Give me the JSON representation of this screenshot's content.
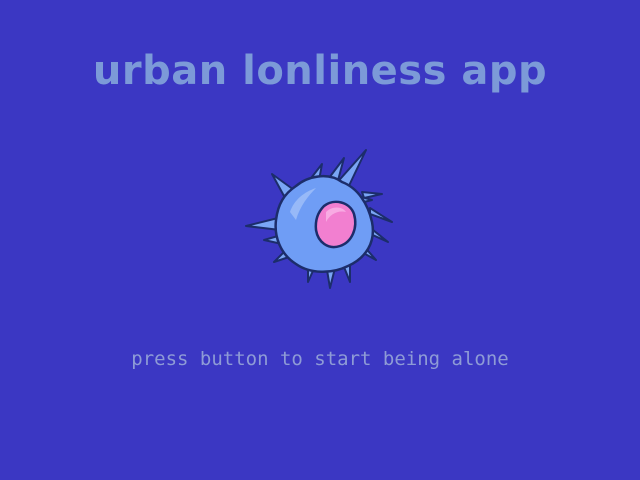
{
  "app": {
    "title": "urban lonliness app",
    "hint": "press button to start being alone"
  },
  "mascot": {
    "icon": "cell-creature-icon"
  },
  "colors": {
    "background": "#3b37c3",
    "title": "#7c9ad8",
    "hint": "#8e9bd6",
    "cell_body": "#6f9df5",
    "cell_nucleus": "#f27fd0"
  }
}
